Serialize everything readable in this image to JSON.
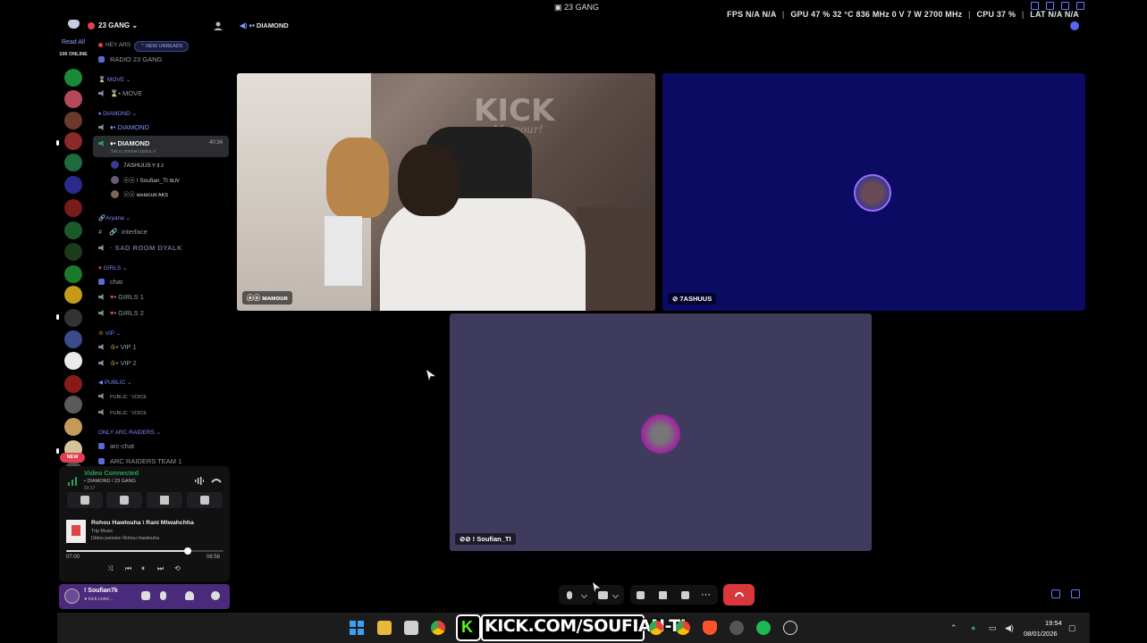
{
  "window_title": "23 GANG",
  "perf": {
    "fps_label": "FPS",
    "fps_value": "N/A",
    "fps_value2": "N/A",
    "gpu_label": "GPU",
    "gpu_load": "47 %",
    "gpu_temp": "32 °C",
    "gpu_clock": "836 MHz",
    "gpu_volt": "0 V",
    "gpu_power": "7 W",
    "gpu_mem": "2700 MHz",
    "cpu_label": "CPU",
    "cpu_load": "37 %",
    "lat_label": "LAT",
    "lat_value": "N/A",
    "lat_value2": "N/A"
  },
  "rail": {
    "read_all": "Read All",
    "online": "106 ONLINE",
    "new_badge": "NEW",
    "servers": [
      {
        "name": "server-1",
        "color": "#1a8a3a"
      },
      {
        "name": "server-2",
        "color": "#b34a5a"
      },
      {
        "name": "server-3",
        "color": "#6b3a2a"
      },
      {
        "name": "server-4",
        "color": "#8a2a2a"
      },
      {
        "name": "server-5",
        "color": "#1d6b3f"
      },
      {
        "name": "server-6",
        "color": "#2a2a8a"
      },
      {
        "name": "server-7",
        "color": "#7a1a1a"
      },
      {
        "name": "server-8",
        "color": "#1a5a2a"
      },
      {
        "name": "server-9",
        "color": "#1a3a1a"
      },
      {
        "name": "server-10",
        "color": "#1a7a2a"
      },
      {
        "name": "server-11",
        "color": "#c49a1a"
      },
      {
        "name": "server-12",
        "color": "#333333"
      },
      {
        "name": "server-13",
        "color": "#3a4a8a"
      },
      {
        "name": "server-14",
        "color": "#eaeaea"
      },
      {
        "name": "server-15",
        "color": "#8a1a1a"
      },
      {
        "name": "server-16",
        "color": "#5a5a5a"
      },
      {
        "name": "server-17",
        "color": "#c49a5a"
      },
      {
        "name": "server-18",
        "color": "#d4c49a"
      },
      {
        "name": "server-19",
        "color": "#4a4a4a"
      }
    ]
  },
  "server": {
    "name": "23 GANG ⌄",
    "new_unreads": "⌃ NEW UNREADS",
    "channels": {
      "hey": "HEY ARS",
      "radio": "RADIO 23 GANG",
      "move_cat": "MOVE ⌄",
      "move_ch": "• MOVE",
      "diamond_cat": "DIAMOND ⌄",
      "diamond_ch1": "• DIAMOND",
      "diamond_ch2": "• DIAMOND",
      "diamond_status": "Set a channel status ✐",
      "timer": "40:34",
      "aryana_cat": "Aryana ⌄",
      "interface": "· interface",
      "sad_room": "· SAD ROOM DYALK",
      "girls_cat": "GIRLS ⌄",
      "chat": "chat",
      "girls1": "• GIRLS 1",
      "girls2": "• GIRLS 2",
      "vip_cat": "VIP ⌄",
      "vip1": "• VIP 1",
      "vip2": "• VIP 2",
      "public_cat": "PUBLIC ⌄",
      "public1": "PUBLIC ' VOICE",
      "public2": "PUBLIC ' VOICE",
      "arc_cat": "ONLY ARC RAIDERS ⌄",
      "arc_chat": "arc-chat",
      "arc_team": "ARC RAIDERS TEAM 1"
    },
    "voice_users": [
      {
        "name": "7ASHUUS",
        "tag": "Y 3 J",
        "color": "#3b3a8c"
      },
      {
        "name": "ⓞⓞ ! Soufian_TI",
        "tag": "SUV",
        "color": "#6a5a7a"
      },
      {
        "name": "ⓞⓞ ᴍᴀᴍᴏᴜʀ",
        "tag": "AKS",
        "color": "#7a6a5a"
      }
    ]
  },
  "voice_panel": {
    "status": "Video Connected",
    "channel": "• DIAMOND / 23 GANG",
    "time": "02:17"
  },
  "music": {
    "title": "Rohou Hawlouha \\ Rani Mtwahchha",
    "album": "Trip Music",
    "artist": "Didou parisien Rohou Hawlouha",
    "elapsed": "07:00",
    "total": "08:58",
    "progress": 0.77
  },
  "user": {
    "name": "! Soufian7k",
    "sub": "● kick.com/..."
  },
  "call": {
    "header": "• DIAMOND",
    "tiles": [
      {
        "label": "ⓞⓞ ᴍᴀᴍᴏᴜʀ"
      },
      {
        "label": "7ASHUUS"
      },
      {
        "label": "! Soufian_TI"
      }
    ],
    "kick_sign": "KICK",
    "kick_sub": "Mamour!"
  },
  "taskbar": {
    "kick_letter": "K",
    "kick_url": "KICK.COM/SOUFIAN-TI",
    "time": "19:54",
    "date": "08/01/2026"
  },
  "colors": {
    "accent": "#5865f2",
    "leave_red": "#da373c",
    "connected_green": "#23a55a",
    "kick_green": "#53fc18"
  }
}
